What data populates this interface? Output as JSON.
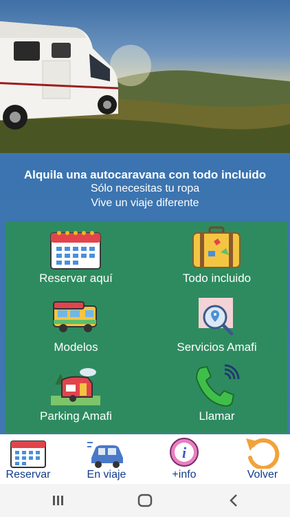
{
  "hero": {
    "image": "motorhome-landscape-photo"
  },
  "tagline": {
    "line1": "Alquila una autocaravana con todo incluido",
    "line2": "Sólo necesitas tu ropa",
    "line3": "Vive un viaje diferente"
  },
  "grid": {
    "items": [
      {
        "label": "Reservar aquí",
        "icon": "calendar-icon"
      },
      {
        "label": "Todo incluido",
        "icon": "suitcase-icon"
      },
      {
        "label": "Modelos",
        "icon": "camper-van-icon"
      },
      {
        "label": "Servicios Amafi",
        "icon": "map-search-icon"
      },
      {
        "label": "Parking Amafi",
        "icon": "caravan-park-icon"
      },
      {
        "label": "Llamar",
        "icon": "phone-call-icon"
      }
    ]
  },
  "bottom_nav": {
    "items": [
      {
        "label": "Reservar",
        "icon": "calendar-icon"
      },
      {
        "label": "En viaje",
        "icon": "car-icon"
      },
      {
        "label": "+info",
        "icon": "info-icon"
      },
      {
        "label": "Volver",
        "icon": "return-arrow-icon"
      }
    ]
  },
  "system_nav": {
    "recents": "recents-icon",
    "home": "home-icon",
    "back": "back-icon"
  },
  "colors": {
    "band": "#3b74b0",
    "grid": "#2e8b60",
    "nav_text": "#123b8a"
  }
}
